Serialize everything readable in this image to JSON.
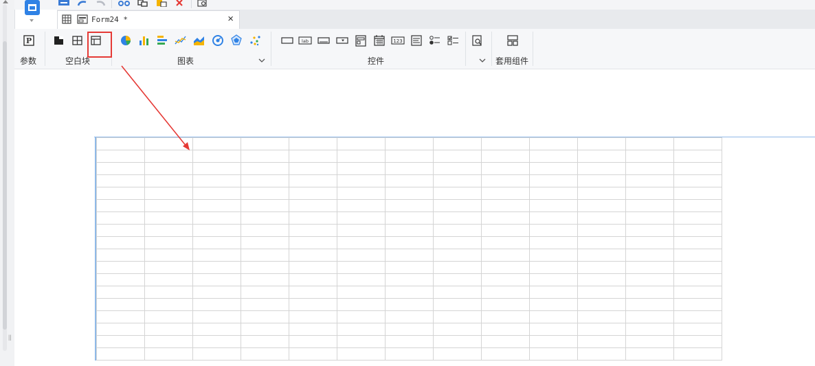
{
  "tab": {
    "title": "Form24 *",
    "close_glyph": "×"
  },
  "ribbon": {
    "groups": {
      "params": "参数",
      "blank_block": "空白块",
      "chart": "图表",
      "controls": "控件",
      "components": "套用组件"
    },
    "param_icon_text": "P"
  },
  "quickbar_icons": [
    "app-logo-icon",
    "save-icon",
    "undo-icon",
    "redo-icon",
    "cut-icon",
    "copy-icon",
    "paste-icon",
    "delete-icon",
    "preview-icon"
  ],
  "colors": {
    "accent_blue": "#2f82e5",
    "highlight_red": "#e53935",
    "grid_line": "#d4d4d4",
    "sheet_border": "#8fb9e8"
  },
  "grid": {
    "columns": 13,
    "rows": 18
  }
}
